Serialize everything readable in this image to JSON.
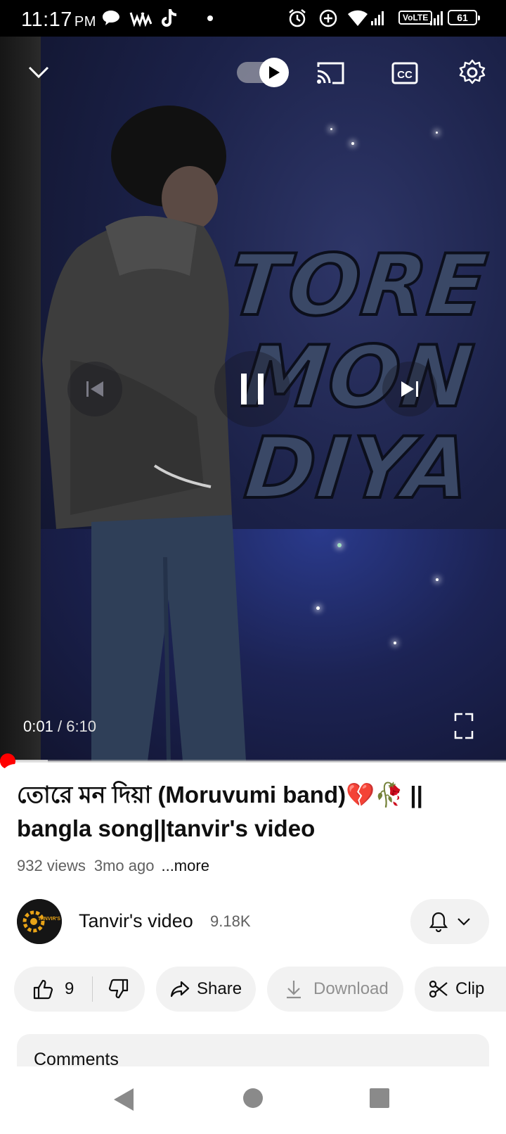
{
  "status_bar": {
    "time": "11:17",
    "ampm": "PM",
    "network_label": "VoLTE",
    "battery": "61"
  },
  "player": {
    "artwork_text": [
      "TORE",
      "MON",
      "DIYA"
    ],
    "current_time": "0:01",
    "separator": "/",
    "duration": "6:10",
    "progress_fraction": 0.003,
    "buffered_fraction": 0.095,
    "autoplay_on": true
  },
  "video": {
    "title": "তোরে মন দিয়া (Moruvumi band)💔🥀 || bangla song||tanvir's video",
    "views": "932 views",
    "age": "3mo ago",
    "more_label": "...more"
  },
  "channel": {
    "name": "Tanvir's video",
    "subscribers": "9.18K",
    "avatar_text": "TANVIR'S"
  },
  "actions": {
    "like_count": "9",
    "share_label": "Share",
    "download_label": "Download",
    "clip_label": "Clip"
  },
  "comments": {
    "header": "Comments"
  },
  "colors": {
    "accent": "#ff0000",
    "pill_bg": "#f2f2f2",
    "secondary_text": "#606060"
  }
}
